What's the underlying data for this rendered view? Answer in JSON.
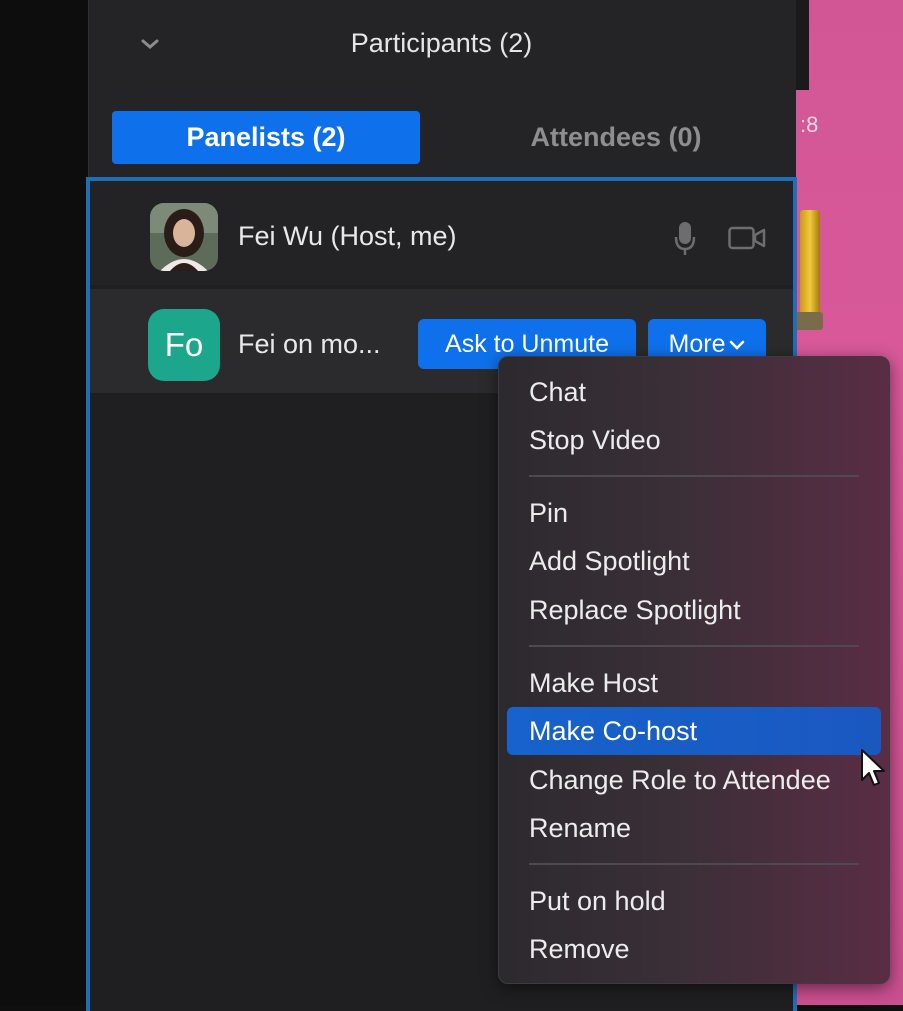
{
  "panel": {
    "title": "Participants (2)",
    "collapse_icon": "chevron-down-icon"
  },
  "tabs": [
    {
      "label": "Panelists (2)",
      "active": true
    },
    {
      "label": "Attendees (0)",
      "active": false
    }
  ],
  "participants": [
    {
      "name": "Fei Wu (Host, me)",
      "avatar": "photo",
      "icons": [
        "microphone-icon",
        "video-camera-icon"
      ]
    },
    {
      "name": "Fei on mo...",
      "avatar_initials": "Fo",
      "avatar_color": "#1ca68c",
      "buttons": {
        "unmute": "Ask to Unmute",
        "more": "More"
      }
    }
  ],
  "menu": {
    "items": [
      "Chat",
      "Stop Video",
      "Pin",
      "Add Spotlight",
      "Replace Spotlight",
      "Make Host",
      "Make Co-host",
      "Change Role to Attendee",
      "Rename",
      "Put on hold",
      "Remove"
    ],
    "highlighted": "Make Co-host"
  },
  "desktop": {
    "fragment_text": ":8"
  },
  "colors": {
    "accent": "#0e71eb",
    "panel_bg": "#242426",
    "desktop_pink": "#d25696",
    "avatar_green": "#1ca68c"
  }
}
